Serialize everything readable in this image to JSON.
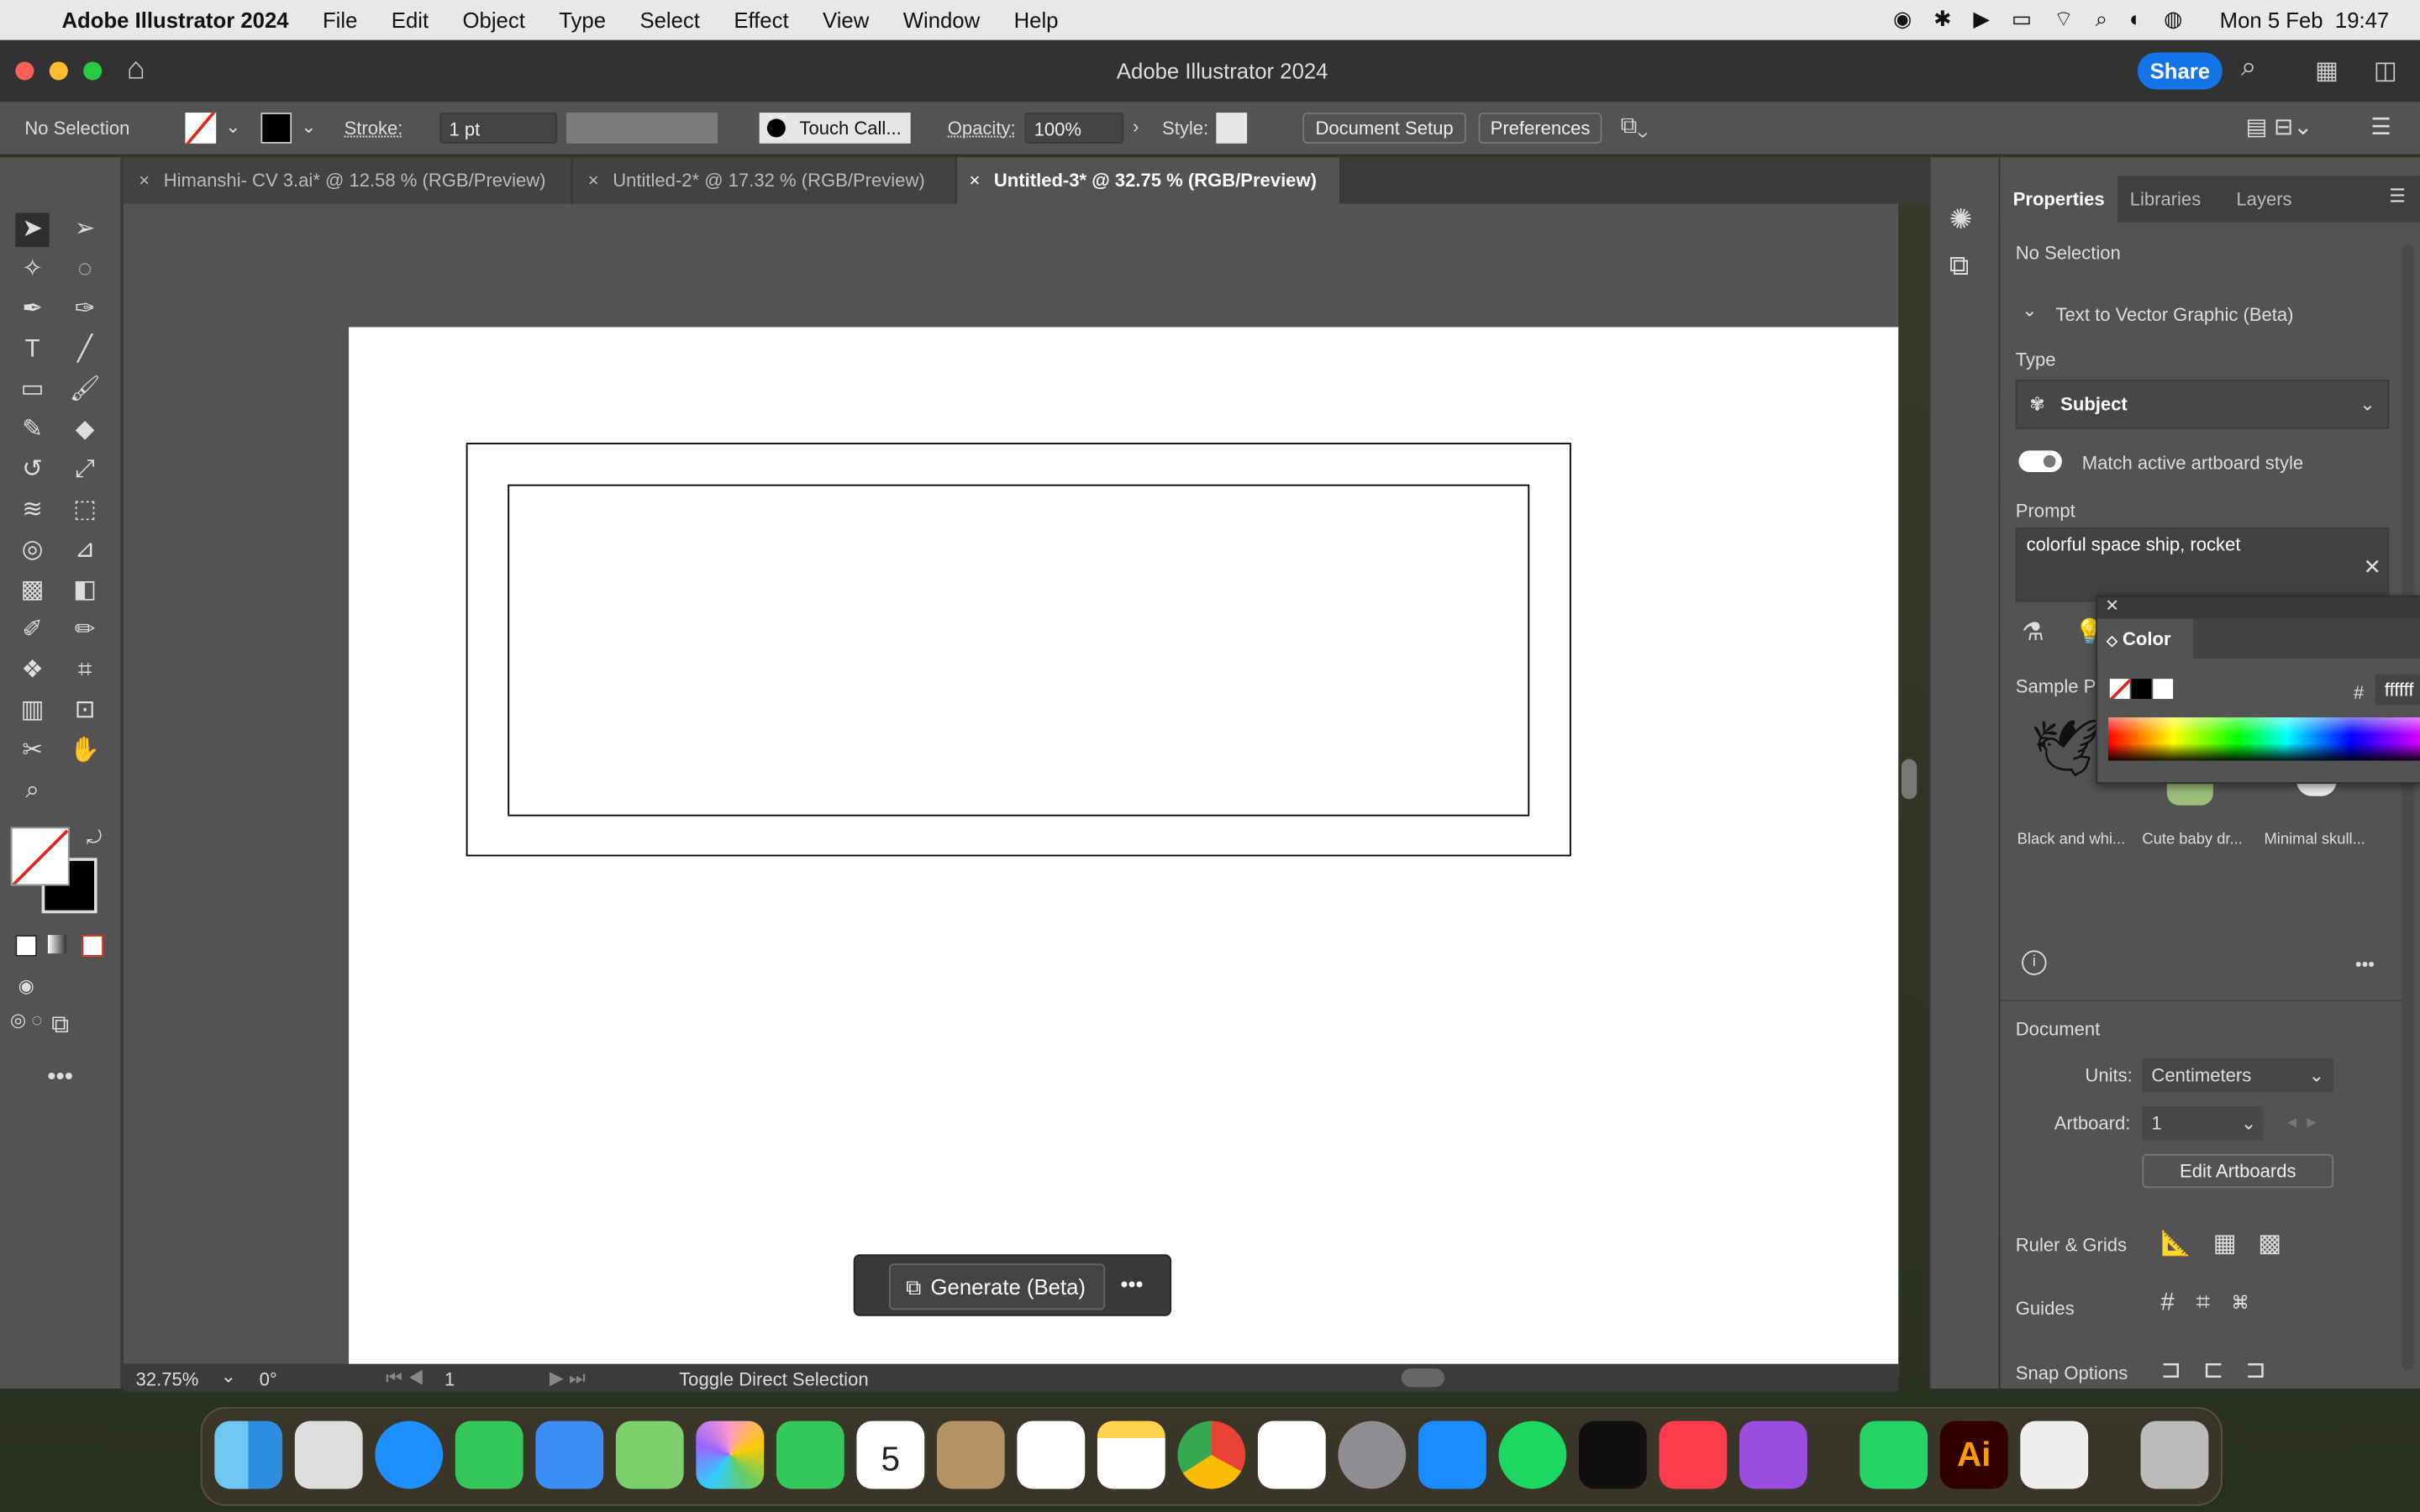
{
  "menubar": {
    "app": "Adobe Illustrator 2024",
    "items": [
      "File",
      "Edit",
      "Object",
      "Type",
      "Select",
      "Effect",
      "View",
      "Window",
      "Help"
    ],
    "clock": "Mon 5 Feb  19:47"
  },
  "titlebar": {
    "title": "Adobe Illustrator 2024",
    "share": "Share"
  },
  "control": {
    "selection": "No Selection",
    "stroke_label": "Stroke:",
    "stroke_value": "1 pt",
    "brush": "Touch Call...",
    "opacity_label": "Opacity:",
    "opacity_value": "100%",
    "style_label": "Style:",
    "doc_setup": "Document Setup",
    "preferences": "Preferences"
  },
  "tabs": [
    {
      "label": "Himanshi- CV 3.ai* @ 12.58 % (RGB/Preview)"
    },
    {
      "label": "Untitled-2* @ 17.32 % (RGB/Preview)"
    },
    {
      "label": "Untitled-3* @ 32.75 % (RGB/Preview)",
      "active": true
    }
  ],
  "generate": {
    "label": "Generate (Beta)"
  },
  "status": {
    "zoom": "32.75%",
    "rotation": "0°",
    "artboard": "1",
    "tool_hint": "Toggle Direct Selection"
  },
  "panel": {
    "tabs": [
      "Properties",
      "Libraries",
      "Layers"
    ],
    "selection": "No Selection",
    "section": "Text to Vector Graphic (Beta)",
    "type_label": "Type",
    "type_value": "Subject",
    "match_label": "Match active artboard style",
    "match_on": true,
    "prompt_label": "Prompt",
    "prompt_value": "colorful space ship, rocket",
    "sample_label": "Sample Pr",
    "samples": [
      "Black and whi...",
      "Cute baby dr...",
      "Minimal skull..."
    ],
    "document_label": "Document",
    "units_label": "Units:",
    "units_value": "Centimeters",
    "artboard_label": "Artboard:",
    "artboard_value": "1",
    "edit_artboards": "Edit Artboards",
    "ruler": "Ruler & Grids",
    "guides": "Guides",
    "snap": "Snap Options"
  },
  "color_panel": {
    "title": "Color",
    "hash": "#",
    "hex": "ffffff"
  },
  "colors": {
    "accent": "#1473e6",
    "ui_bg": "#535353",
    "dark": "#323232"
  }
}
